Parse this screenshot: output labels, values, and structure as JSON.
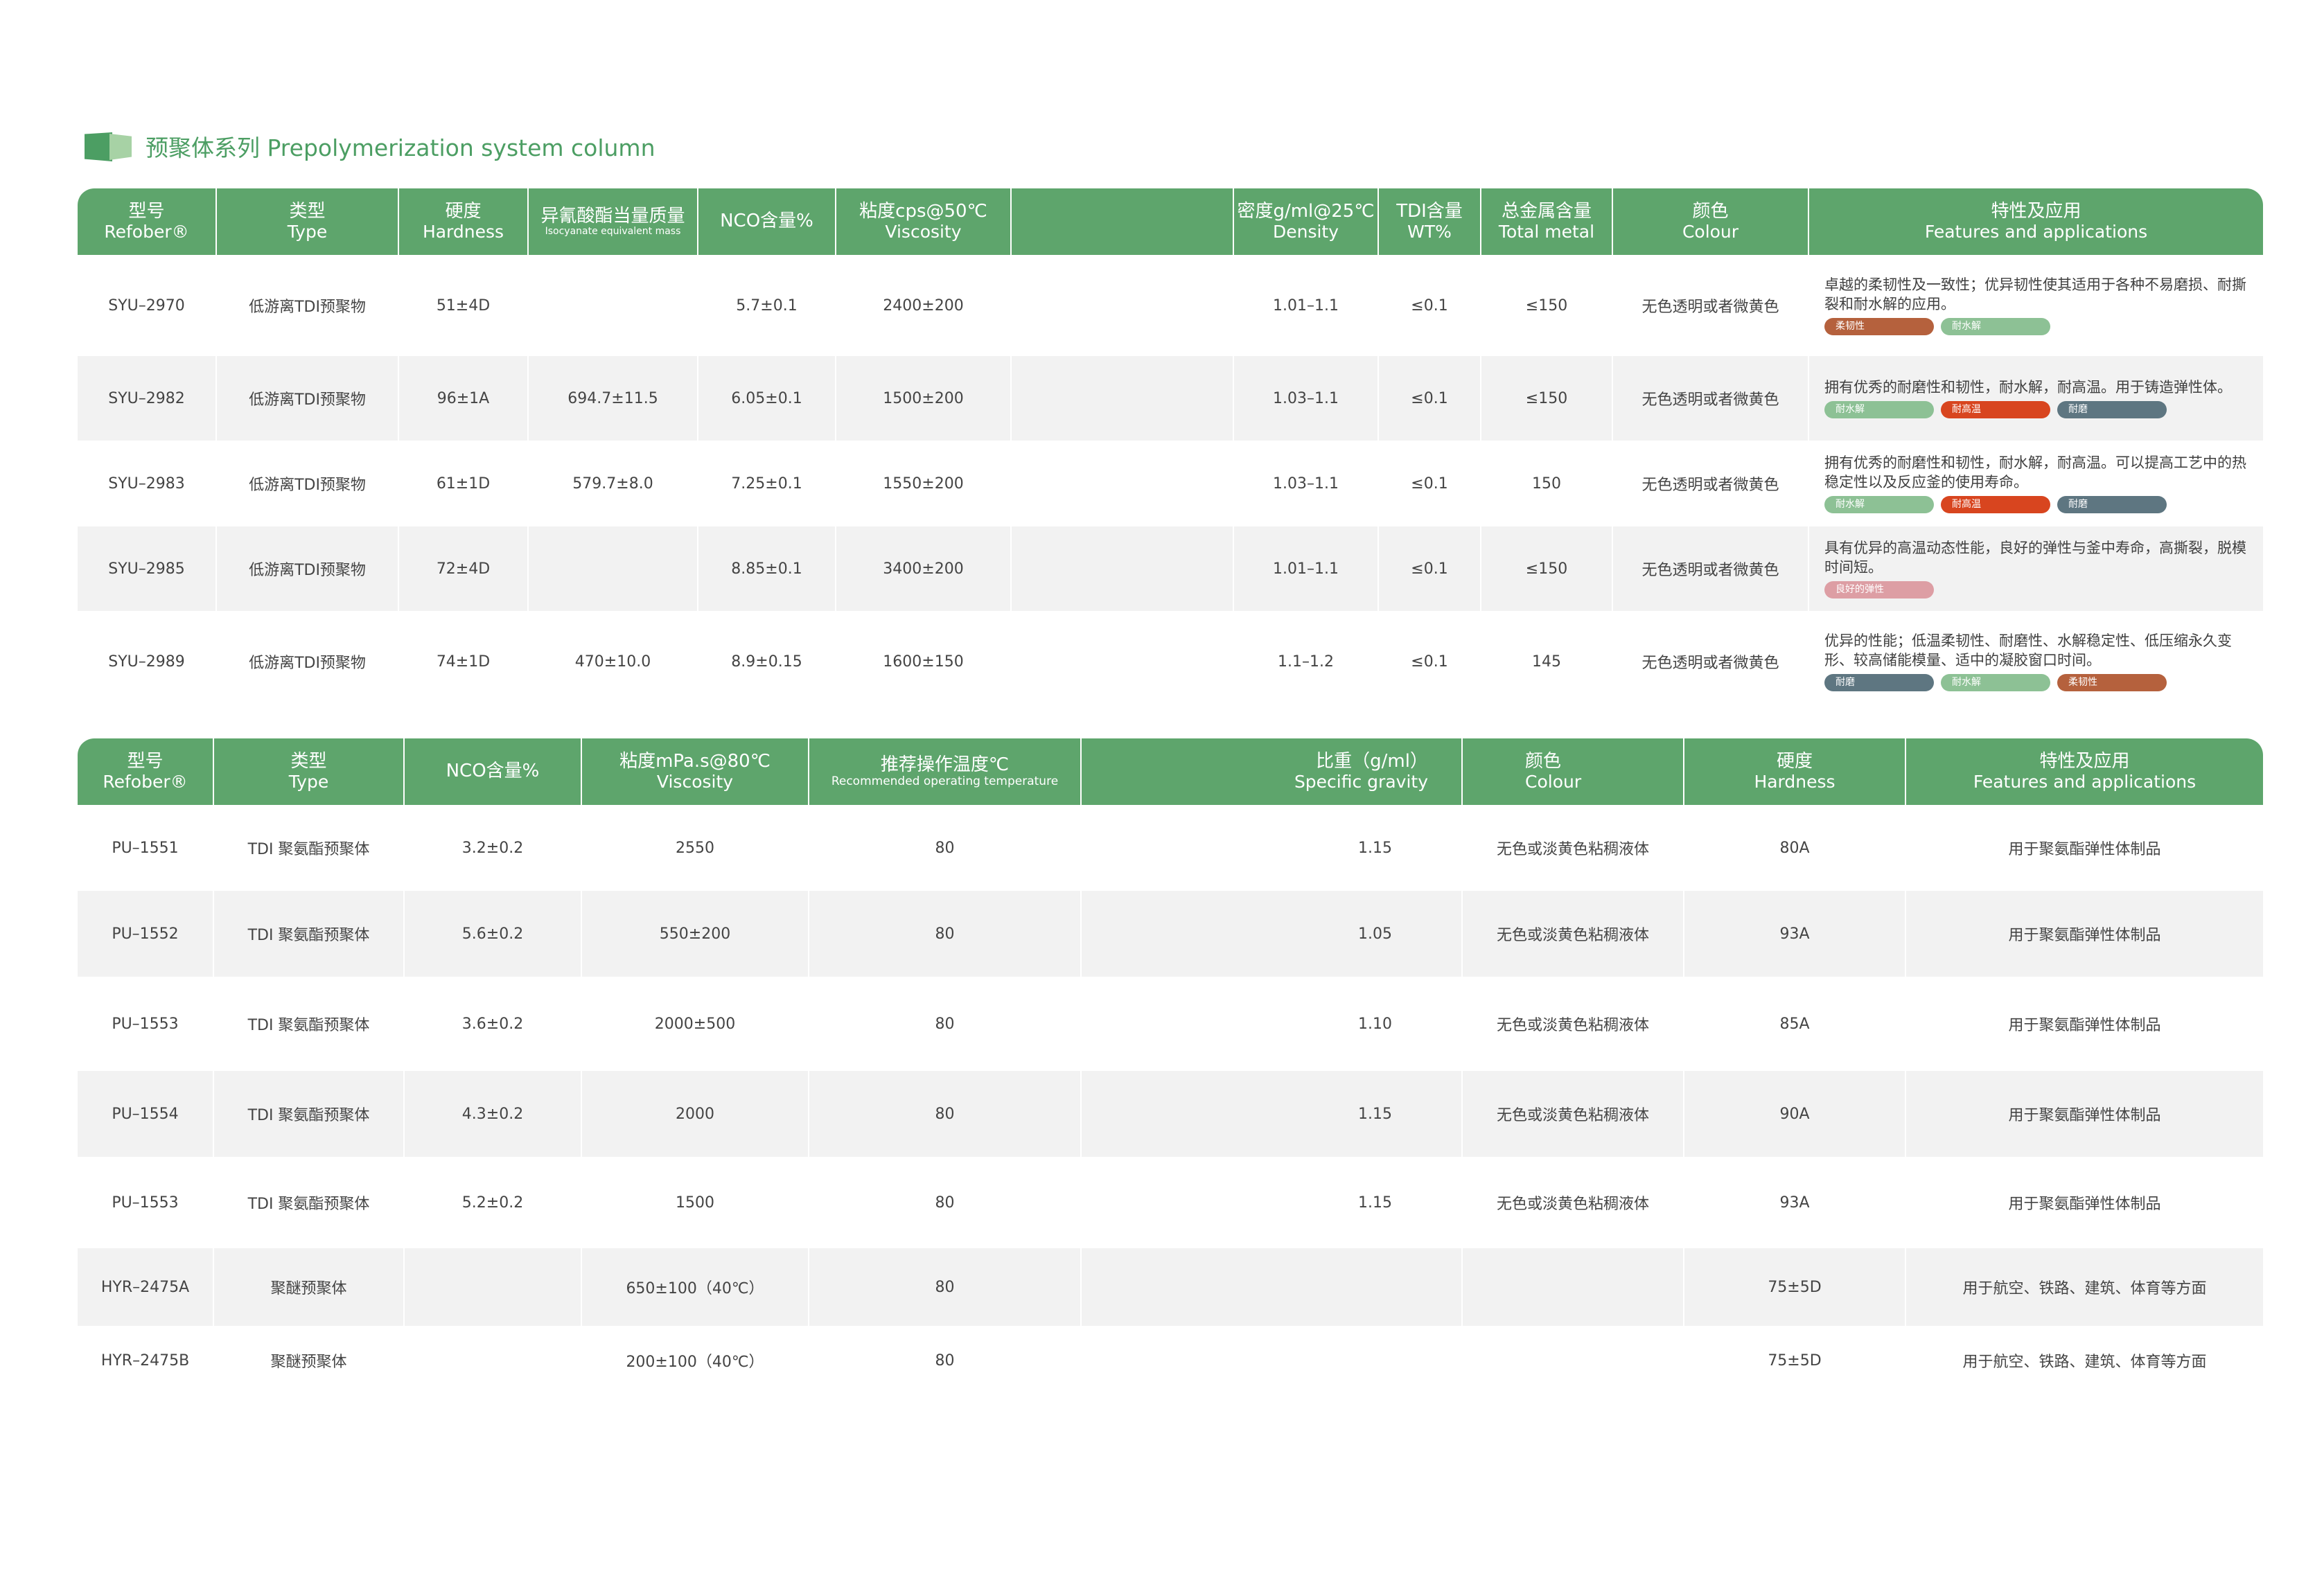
{
  "section_title": "预聚体系列 Prepolymerization system column",
  "table1": {
    "headers": [
      {
        "zh": "型号",
        "en": "Refober®"
      },
      {
        "zh": "类型",
        "en": "Type"
      },
      {
        "zh": "硬度",
        "en": "Hardness"
      },
      {
        "zh": "异氰酸酯当量质量",
        "en": "Isocyanate equivalent mass"
      },
      {
        "zh": "NCO含量%",
        "en": ""
      },
      {
        "zh": "粘度cps@50℃",
        "en": "Viscosity"
      },
      {
        "zh": "",
        "en": ""
      },
      {
        "zh": "密度g/ml@25℃",
        "en": "Density"
      },
      {
        "zh": "TDI含量",
        "en": "WT%"
      },
      {
        "zh": "总金属含量",
        "en": "Total metal"
      },
      {
        "zh": "颜色",
        "en": "Colour"
      },
      {
        "zh": "特性及应用",
        "en": "Features and applications"
      }
    ],
    "rows": [
      {
        "cells": [
          "SYU–2970",
          "低游离TDI预聚物",
          "51±4D",
          "",
          "5.7±0.1",
          "2400±200",
          "",
          "1.01–1.1",
          "≤0.1",
          "≤150",
          "无色透明或者微黄色"
        ],
        "feature": "卓越的柔韧性及一致性；优异韧性使其适用于各种不易磨损、耐撕裂和耐水解的应用。",
        "tags": [
          {
            "label": "柔韧性",
            "color": "#b5613d"
          },
          {
            "label": "耐水解",
            "color": "#8dc195"
          }
        ]
      },
      {
        "cells": [
          "SYU–2982",
          "低游离TDI预聚物",
          "96±1A",
          "694.7±11.5",
          "6.05±0.1",
          "1500±200",
          "",
          "1.03–1.1",
          "≤0.1",
          "≤150",
          "无色透明或者微黄色"
        ],
        "feature": "拥有优秀的耐磨性和韧性，耐水解，耐高温。用于铸造弹性体。",
        "tags": [
          {
            "label": "耐水解",
            "color": "#8dc195"
          },
          {
            "label": "耐高温",
            "color": "#d8451f"
          },
          {
            "label": "耐磨",
            "color": "#5e7681"
          }
        ]
      },
      {
        "cells": [
          "SYU–2983",
          "低游离TDI预聚物",
          "61±1D",
          "579.7±8.0",
          "7.25±0.1",
          "1550±200",
          "",
          "1.03–1.1",
          "≤0.1",
          "150",
          "无色透明或者微黄色"
        ],
        "feature": "拥有优秀的耐磨性和韧性，耐水解，耐高温。可以提高工艺中的热稳定性以及反应釜的使用寿命。",
        "tags": [
          {
            "label": "耐水解",
            "color": "#8dc195"
          },
          {
            "label": "耐高温",
            "color": "#d8451f"
          },
          {
            "label": "耐磨",
            "color": "#5e7681"
          }
        ]
      },
      {
        "cells": [
          "SYU–2985",
          "低游离TDI预聚物",
          "72±4D",
          "",
          "8.85±0.1",
          "3400±200",
          "",
          "1.01–1.1",
          "≤0.1",
          "≤150",
          "无色透明或者微黄色"
        ],
        "feature": "具有优异的高温动态性能，良好的弹性与釜中寿命，高撕裂，脱模时间短。",
        "tags": [
          {
            "label": "良好的弹性",
            "color": "#dd9ea4"
          }
        ]
      },
      {
        "cells": [
          "SYU–2989",
          "低游离TDI预聚物",
          "74±1D",
          "470±10.0",
          "8.9±0.15",
          "1600±150",
          "",
          "1.1–1.2",
          "≤0.1",
          "145",
          "无色透明或者微黄色"
        ],
        "feature": "优异的性能；低温柔韧性、耐磨性、水解稳定性、低压缩永久变形、较高储能模量、适中的凝胶窗口时间。",
        "tags": [
          {
            "label": "耐磨",
            "color": "#5e7681"
          },
          {
            "label": "耐水解",
            "color": "#8dc195"
          },
          {
            "label": "柔韧性",
            "color": "#b5613d"
          }
        ]
      }
    ]
  },
  "table2": {
    "headers": [
      {
        "zh": "型号",
        "en": "Refober®"
      },
      {
        "zh": "类型",
        "en": "Type"
      },
      {
        "zh": "NCO含量%",
        "en": ""
      },
      {
        "zh": "粘度mPa.s@80℃",
        "en": "Viscosity"
      },
      {
        "zh": "推荐操作温度℃",
        "en": "Recommended operating temperature"
      },
      {
        "zh": "比重（g/ml）",
        "en": "Specific gravity"
      },
      {
        "zh": "颜色",
        "en": "Colour"
      },
      {
        "zh": "硬度",
        "en": "Hardness"
      },
      {
        "zh": "特性及应用",
        "en": "Features and applications"
      }
    ],
    "rows": [
      [
        "PU–1551",
        "TDI 聚氨酯预聚体",
        "3.2±0.2",
        "2550",
        "80",
        "1.15",
        "无色或淡黄色粘稠液体",
        "80A",
        "用于聚氨酯弹性体制品"
      ],
      [
        "PU–1552",
        "TDI 聚氨酯预聚体",
        "5.6±0.2",
        "550±200",
        "80",
        "1.05",
        "无色或淡黄色粘稠液体",
        "93A",
        "用于聚氨酯弹性体制品"
      ],
      [
        "PU–1553",
        "TDI 聚氨酯预聚体",
        "3.6±0.2",
        "2000±500",
        "80",
        "1.10",
        "无色或淡黄色粘稠液体",
        "85A",
        "用于聚氨酯弹性体制品"
      ],
      [
        "PU–1554",
        "TDI 聚氨酯预聚体",
        "4.3±0.2",
        "2000",
        "80",
        "1.15",
        "无色或淡黄色粘稠液体",
        "90A",
        "用于聚氨酯弹性体制品"
      ],
      [
        "PU–1553",
        "TDI 聚氨酯预聚体",
        "5.2±0.2",
        "1500",
        "80",
        "1.15",
        "无色或淡黄色粘稠液体",
        "93A",
        "用于聚氨酯弹性体制品"
      ],
      [
        "HYR–2475A",
        "聚醚预聚体",
        "",
        "650±100（40℃）",
        "80",
        "",
        "",
        "75±5D",
        "用于航空、铁路、建筑、体育等方面"
      ],
      [
        "HYR–2475B",
        "聚醚预聚体",
        "",
        "200±100（40℃）",
        "80",
        "",
        "",
        "75±5D",
        "用于航空、铁路、建筑、体育等方面"
      ]
    ]
  }
}
